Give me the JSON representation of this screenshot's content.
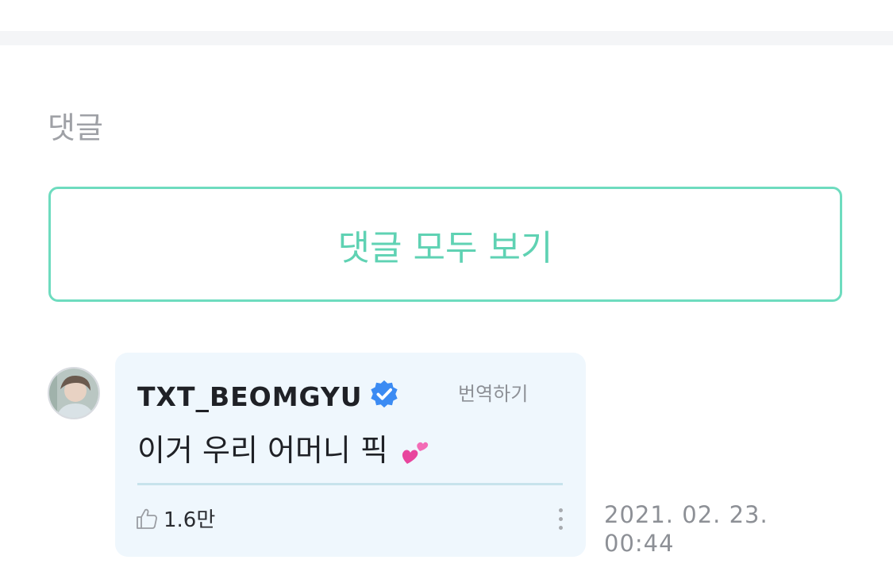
{
  "section": {
    "title": "댓글"
  },
  "view_all": {
    "label": "댓글 모두 보기"
  },
  "comment": {
    "author": "TXT_BEOMGYU",
    "verified_icon": "verified-badge-icon",
    "translate_label": "번역하기",
    "text": "이거 우리 어머니 픽",
    "emoji_icon": "two-hearts-icon",
    "likes": "1.6만",
    "timestamp_date": "2021. 02. 23.",
    "timestamp_time": "00:44"
  },
  "colors": {
    "accent": "#6edcbf",
    "accent_text": "#5fd2b3",
    "bubble_bg": "#eff7fd",
    "verified_blue": "#3b8bf3",
    "muted": "#8d9096"
  }
}
